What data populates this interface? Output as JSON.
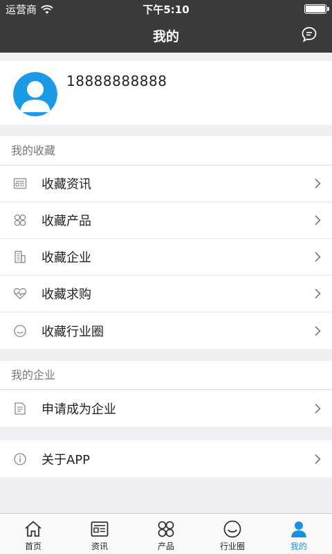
{
  "status_bar": {
    "carrier": "运营商",
    "time": "下午5:10"
  },
  "nav": {
    "title": "我的",
    "message_icon": "chat-bubble-icon"
  },
  "profile": {
    "phone": "18888888888",
    "avatar_icon": "user-avatar-icon"
  },
  "favorites": {
    "header": "我的收藏",
    "items": [
      {
        "label": "收藏资讯",
        "icon": "news-icon"
      },
      {
        "label": "收藏产品",
        "icon": "product-grid-icon"
      },
      {
        "label": "收藏企业",
        "icon": "building-icon"
      },
      {
        "label": "收藏求购",
        "icon": "heartbeat-icon"
      },
      {
        "label": "收藏行业圈",
        "icon": "smile-icon"
      }
    ]
  },
  "company": {
    "header": "我的企业",
    "items": [
      {
        "label": "申请成为企业",
        "icon": "document-icon"
      }
    ]
  },
  "about": {
    "items": [
      {
        "label": "关于APP",
        "icon": "info-icon"
      }
    ]
  },
  "tabbar": {
    "active_color": "#1a8fe3",
    "tabs": [
      {
        "label": "首页",
        "icon": "home-icon"
      },
      {
        "label": "资讯",
        "icon": "news-icon"
      },
      {
        "label": "产品",
        "icon": "product-grid-icon"
      },
      {
        "label": "行业圈",
        "icon": "smile-icon"
      },
      {
        "label": "我的",
        "icon": "user-icon",
        "active": true
      }
    ]
  }
}
